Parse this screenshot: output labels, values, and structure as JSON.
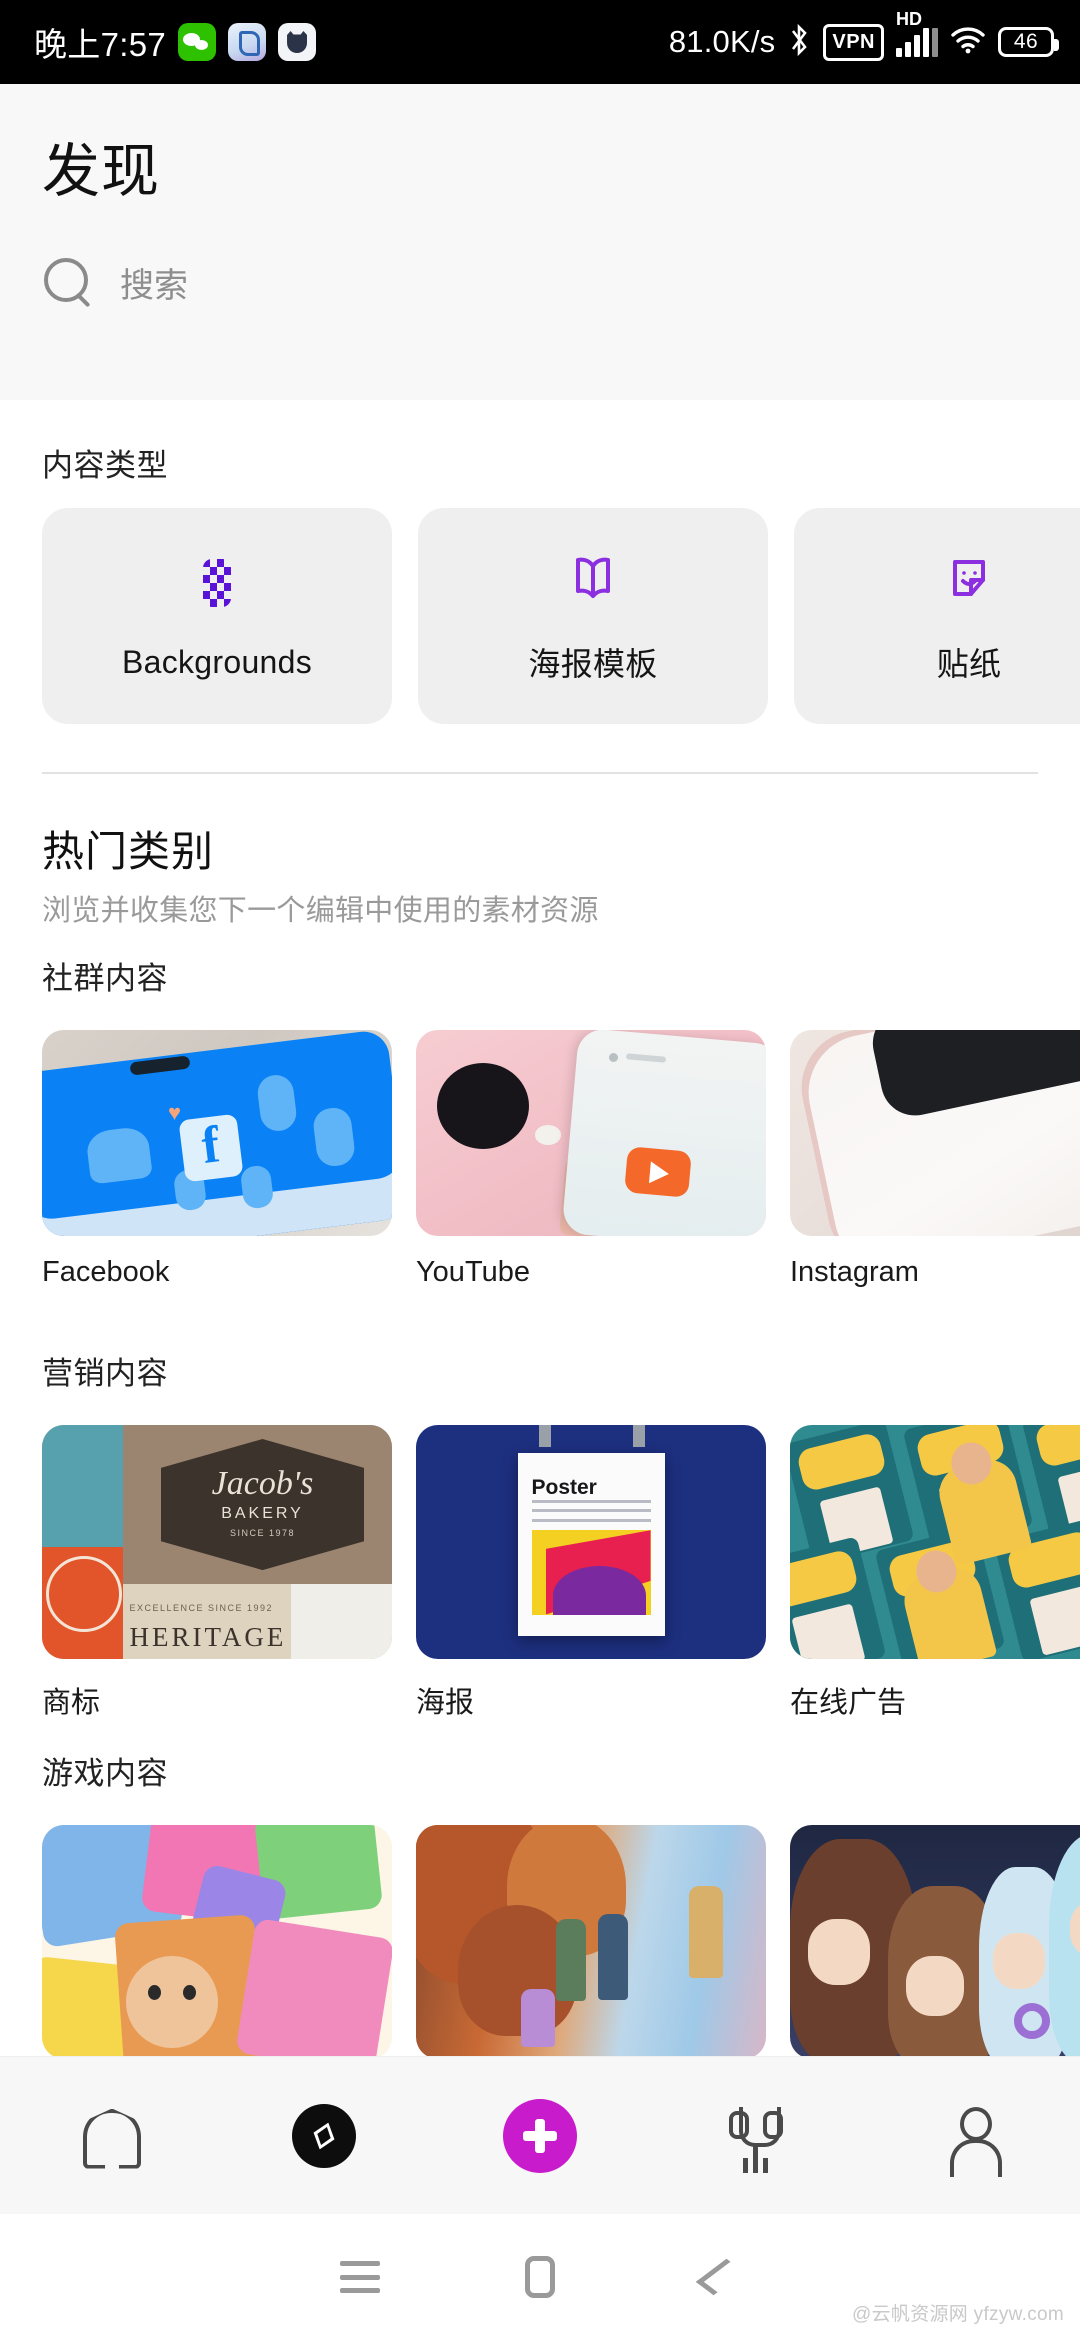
{
  "status_bar": {
    "time": "晚上7:57",
    "app_icons": [
      "wechat-icon",
      "alipay-icon",
      "cat-app-icon"
    ],
    "network_speed": "81.0K/s",
    "bluetooth": "bluetooth-icon",
    "vpn": "VPN",
    "hd": "HD",
    "signal": "signal-bars-icon",
    "wifi": "wifi-icon",
    "battery_level": "46"
  },
  "header": {
    "title": "发现",
    "search_placeholder": "搜索",
    "search_value": ""
  },
  "content_type": {
    "label": "内容类型",
    "cards": [
      {
        "label": "Backgrounds",
        "icon": "checkerboard-icon"
      },
      {
        "label": "海报模板",
        "icon": "open-book-icon"
      },
      {
        "label": "贴纸",
        "icon": "sticker-icon"
      }
    ]
  },
  "popular": {
    "title": "热门类别",
    "subtitle": "浏览并收集您下一个编辑中使用的素材资源"
  },
  "groups": [
    {
      "title": "社群内容",
      "tiles": [
        {
          "label": "Facebook"
        },
        {
          "label": "YouTube"
        },
        {
          "label": "Instagram"
        }
      ]
    },
    {
      "title": "营销内容",
      "tiles": [
        {
          "label": "商标"
        },
        {
          "label": "海报"
        },
        {
          "label": "在线广告"
        }
      ]
    },
    {
      "title": "游戏内容",
      "tiles": [
        {
          "label": ""
        },
        {
          "label": ""
        },
        {
          "label": ""
        }
      ]
    }
  ],
  "tile_art": {
    "logo_name": "Jacob's",
    "logo_sub": "BAKERY",
    "logo_since": "SINCE 1978",
    "logo_heritage": "HERITAGE",
    "logo_excellence": "EXCELLENCE SINCE 1992",
    "poster_title": "Poster"
  },
  "bottom_nav": [
    {
      "name": "home-icon",
      "active": false
    },
    {
      "name": "compass-icon",
      "active": true
    },
    {
      "name": "plus-icon",
      "active": false
    },
    {
      "name": "trophy-icon",
      "active": false
    },
    {
      "name": "person-icon",
      "active": false
    }
  ],
  "android_nav": {
    "recents": "recents-icon",
    "home": "home-square-icon",
    "back": "back-chevron-icon"
  },
  "watermark": "@云帆资源网 yfzyw.com",
  "colors": {
    "accent_purple": "#5B12D8",
    "icon_purple": "#8B2FE0",
    "fab_magenta": "#C81BCB",
    "header_bg": "#F8F8F8",
    "card_bg": "#EFEFEF"
  }
}
